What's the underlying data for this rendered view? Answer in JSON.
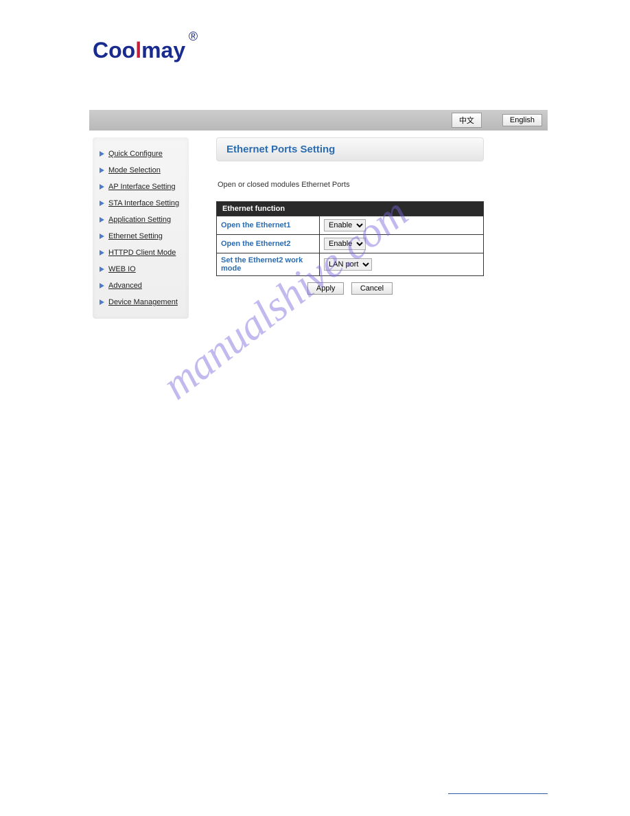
{
  "logo": {
    "part1": "Coo",
    "part2": "l",
    "part3": "may",
    "reg": "®"
  },
  "topbar": {
    "lang_cn": "中文",
    "lang_en": "English"
  },
  "sidebar": {
    "items": [
      {
        "label": "Quick Configure"
      },
      {
        "label": "Mode Selection"
      },
      {
        "label": "AP Interface Setting"
      },
      {
        "label": "STA Interface Setting"
      },
      {
        "label": "Application Setting"
      },
      {
        "label": "Ethernet Setting"
      },
      {
        "label": "HTTPD Client Mode"
      },
      {
        "label": "WEB IO"
      },
      {
        "label": "Advanced"
      },
      {
        "label": "Device Management"
      }
    ]
  },
  "page": {
    "title": "Ethernet Ports Setting",
    "description": "Open or closed modules Ethernet Ports"
  },
  "table": {
    "header": "Ethernet function",
    "rows": [
      {
        "label": "Open the Ethernet1",
        "value": "Enable"
      },
      {
        "label": "Open the Ethernet2",
        "value": "Enable"
      },
      {
        "label": "Set the Ethernet2 work mode",
        "value": "LAN port"
      }
    ]
  },
  "buttons": {
    "apply": "Apply",
    "cancel": "Cancel"
  },
  "watermark": "manualshive.com"
}
